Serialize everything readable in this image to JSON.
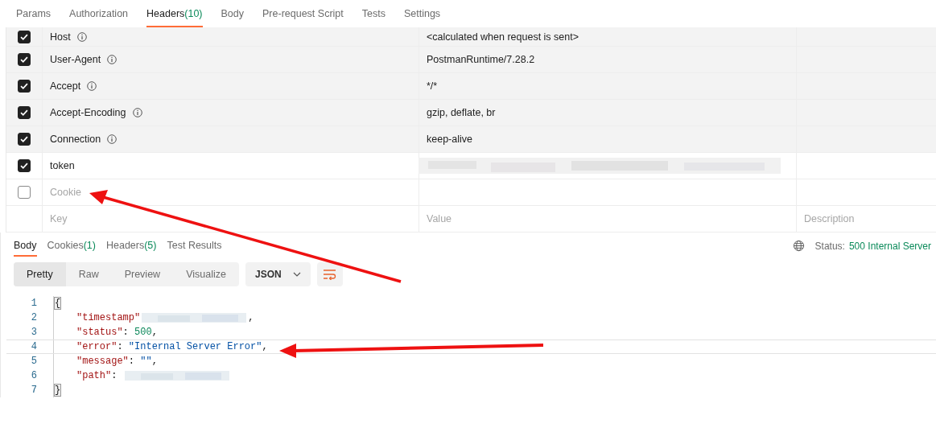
{
  "request_tabs": [
    {
      "label": "Params",
      "selected": false
    },
    {
      "label": "Authorization",
      "selected": false
    },
    {
      "label": "Headers",
      "count": "(10)",
      "selected": true
    },
    {
      "label": "Body",
      "selected": false
    },
    {
      "label": "Pre-request Script",
      "selected": false
    },
    {
      "label": "Tests",
      "selected": false
    },
    {
      "label": "Settings",
      "selected": false
    }
  ],
  "headers": {
    "rows": [
      {
        "key": "Host",
        "info": true,
        "value": "<calculated when request is sent>",
        "checked": true,
        "auto": true
      },
      {
        "key": "User-Agent",
        "info": true,
        "value": "PostmanRuntime/7.28.2",
        "checked": true,
        "auto": true
      },
      {
        "key": "Accept",
        "info": true,
        "value": "*/*",
        "checked": true,
        "auto": true
      },
      {
        "key": "Accept-Encoding",
        "info": true,
        "value": "gzip, deflate, br",
        "checked": true,
        "auto": true
      },
      {
        "key": "Connection",
        "info": true,
        "value": "keep-alive",
        "checked": true,
        "auto": true
      },
      {
        "key": "token",
        "info": false,
        "redacted": true,
        "checked": true,
        "auto": false
      },
      {
        "key": "Cookie",
        "info": false,
        "checked": false,
        "auto": false
      }
    ],
    "new_row": {
      "key_placeholder": "Key",
      "value_placeholder": "Value",
      "description_placeholder": "Description"
    }
  },
  "response": {
    "tabs": [
      {
        "label": "Body",
        "selected": true
      },
      {
        "label": "Cookies",
        "count": "(1)",
        "selected": false
      },
      {
        "label": "Headers",
        "count": "(5)",
        "selected": false
      },
      {
        "label": "Test Results",
        "selected": false
      }
    ],
    "status_label": "Status:",
    "status_value": "500 Internal Server",
    "view_modes": [
      {
        "label": "Pretty",
        "selected": true
      },
      {
        "label": "Raw",
        "selected": false
      },
      {
        "label": "Preview",
        "selected": false
      },
      {
        "label": "Visualize",
        "selected": false
      }
    ],
    "format": "JSON",
    "lines": [
      {
        "number": "1",
        "highlighted": false,
        "tokens": [
          {
            "kind": "bracket",
            "text": "{"
          }
        ]
      },
      {
        "number": "2",
        "highlighted": false,
        "tokens": [
          {
            "kind": "key",
            "text": "\"timestamp\""
          },
          {
            "kind": "redacted"
          },
          {
            "kind": "punct",
            "text": ","
          }
        ]
      },
      {
        "number": "3",
        "highlighted": false,
        "tokens": [
          {
            "kind": "key",
            "text": "\"status\""
          },
          {
            "kind": "punct",
            "text": ": "
          },
          {
            "kind": "number",
            "text": "500"
          },
          {
            "kind": "punct",
            "text": ","
          }
        ]
      },
      {
        "number": "4",
        "highlighted": true,
        "tokens": [
          {
            "kind": "key",
            "text": "\"error\""
          },
          {
            "kind": "punct",
            "text": ": "
          },
          {
            "kind": "string",
            "text": "\"Internal Server Error\""
          },
          {
            "kind": "punct",
            "text": ","
          }
        ]
      },
      {
        "number": "5",
        "highlighted": false,
        "tokens": [
          {
            "kind": "key",
            "text": "\"message\""
          },
          {
            "kind": "punct",
            "text": ": "
          },
          {
            "kind": "string",
            "text": "\"\""
          },
          {
            "kind": "punct",
            "text": ","
          }
        ]
      },
      {
        "number": "6",
        "highlighted": false,
        "tokens": [
          {
            "kind": "key",
            "text": "\"path\""
          },
          {
            "kind": "punct",
            "text": ": "
          },
          {
            "kind": "redacted"
          }
        ]
      },
      {
        "number": "7",
        "highlighted": false,
        "tokens": [
          {
            "kind": "bracket",
            "text": "}"
          }
        ]
      }
    ]
  }
}
